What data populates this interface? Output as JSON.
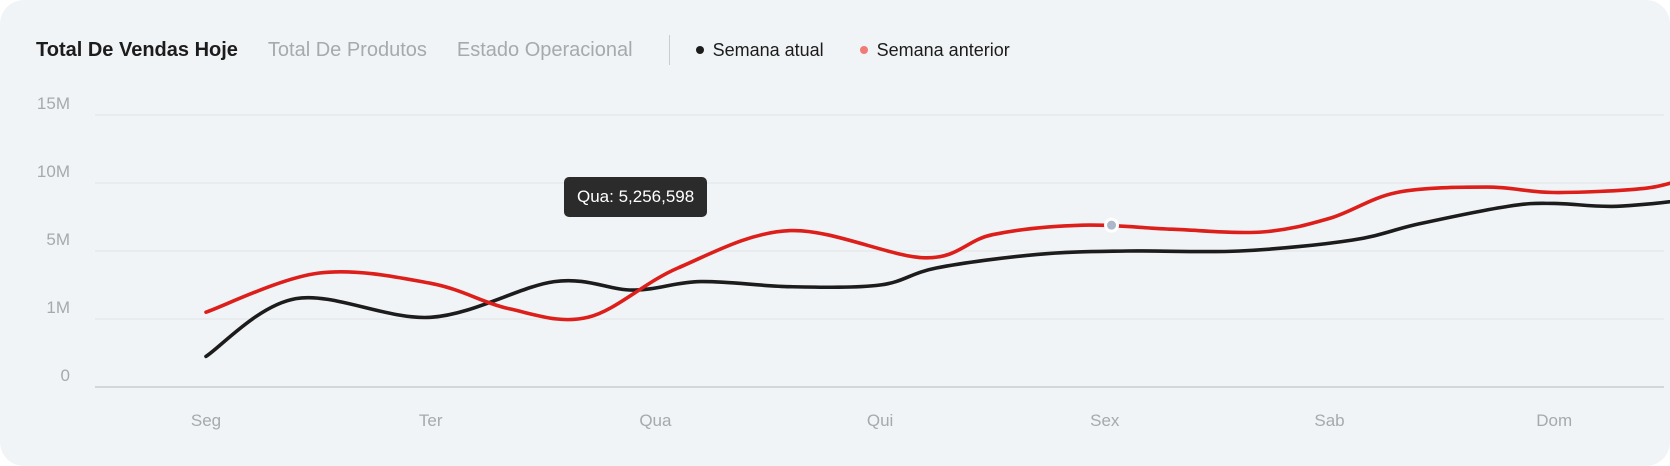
{
  "tabs": [
    {
      "label": "Total De Vendas Hoje",
      "active": true
    },
    {
      "label": "Total De Produtos",
      "active": false
    },
    {
      "label": "Estado Operacional",
      "active": false
    }
  ],
  "colors": {
    "current": "#1c1c1c",
    "previous": "#dc1f1b",
    "legend_previous_dot": "#f07a75",
    "grid": "#e1e4e7",
    "axis": "#c9ccd0"
  },
  "tooltip": {
    "text": "Qua: 5,256,598"
  },
  "chart_data": {
    "type": "line",
    "y_tick_labels": [
      "15M",
      "10M",
      "5M",
      "1M",
      "0"
    ],
    "x_tick_labels": [
      "Seg",
      "Ter",
      "Qua",
      "Qui",
      "Sex",
      "Sab",
      "Dom"
    ],
    "grid": true,
    "legend_position": "top",
    "series": [
      {
        "name": "Semana atual",
        "points": [
          {
            "x": 0.0,
            "y": 0.45
          },
          {
            "x": 0.4,
            "y": 2.2
          },
          {
            "x": 1.0,
            "y": 1.1
          },
          {
            "x": 1.55,
            "y": 3.2
          },
          {
            "x": 1.9,
            "y": 2.7
          },
          {
            "x": 2.2,
            "y": 3.2
          },
          {
            "x": 2.6,
            "y": 2.9
          },
          {
            "x": 3.0,
            "y": 3.0
          },
          {
            "x": 3.25,
            "y": 4.0
          },
          {
            "x": 3.7,
            "y": 4.8
          },
          {
            "x": 4.1,
            "y": 5.0
          },
          {
            "x": 4.6,
            "y": 5.0
          },
          {
            "x": 5.1,
            "y": 5.8
          },
          {
            "x": 5.4,
            "y": 7.0
          },
          {
            "x": 5.8,
            "y": 8.3
          },
          {
            "x": 6.0,
            "y": 8.5
          },
          {
            "x": 6.3,
            "y": 8.3
          },
          {
            "x": 6.7,
            "y": 9.2
          },
          {
            "x": 7.0,
            "y": 11.5
          }
        ]
      },
      {
        "name": "Semana anterior",
        "points": [
          {
            "x": 0.0,
            "y": 1.4
          },
          {
            "x": 0.5,
            "y": 3.7
          },
          {
            "x": 1.0,
            "y": 3.1
          },
          {
            "x": 1.35,
            "y": 1.6
          },
          {
            "x": 1.7,
            "y": 1.1
          },
          {
            "x": 2.1,
            "y": 4.0
          },
          {
            "x": 2.6,
            "y": 6.5
          },
          {
            "x": 3.2,
            "y": 4.6
          },
          {
            "x": 3.5,
            "y": 6.2
          },
          {
            "x": 3.9,
            "y": 6.9
          },
          {
            "x": 4.3,
            "y": 6.6
          },
          {
            "x": 4.7,
            "y": 6.4
          },
          {
            "x": 5.0,
            "y": 7.4
          },
          {
            "x": 5.3,
            "y": 9.3
          },
          {
            "x": 5.7,
            "y": 9.7
          },
          {
            "x": 6.0,
            "y": 9.3
          },
          {
            "x": 6.4,
            "y": 9.6
          },
          {
            "x": 6.6,
            "y": 10.3
          },
          {
            "x": 6.8,
            "y": 10.3
          },
          {
            "x": 7.0,
            "y": 9.0
          }
        ]
      }
    ],
    "highlight": {
      "series": "Semana anterior",
      "x": 4.03,
      "y": 6.9
    }
  }
}
